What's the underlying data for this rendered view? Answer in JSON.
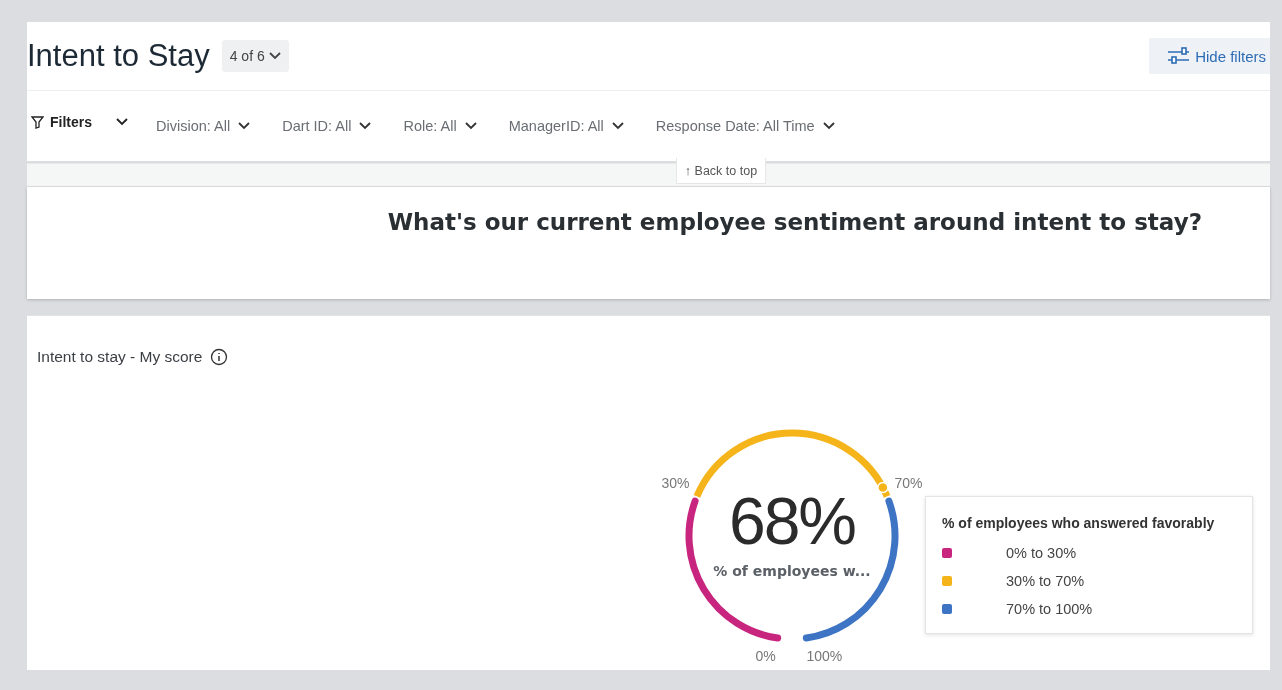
{
  "header": {
    "title": "Intent to Stay",
    "page_picker": "4 of 6",
    "hide_filters": "Hide filters"
  },
  "filters": {
    "label": "Filters",
    "items": [
      {
        "label": "Division:",
        "value": "All"
      },
      {
        "label": "Dart ID:",
        "value": "All"
      },
      {
        "label": "Role:",
        "value": "All"
      },
      {
        "label": "ManagerID:",
        "value": "All"
      },
      {
        "label": "Response Date:",
        "value": "All Time"
      }
    ]
  },
  "back_to_top": "↑ Back to top",
  "question": "What's our current employee sentiment around intent to stay?",
  "score_card": {
    "title": "Intent to stay - My score",
    "gauge": {
      "value": "68%",
      "caption": "% of employees w...",
      "ticks": [
        "0%",
        "30%",
        "70%",
        "100%"
      ]
    },
    "legend": {
      "title": "% of employees who answered favorably",
      "items": [
        {
          "label": "0% to 30%",
          "color": "#c8267e"
        },
        {
          "label": "30% to 70%",
          "color": "#f4b41a"
        },
        {
          "label": "70% to 100%",
          "color": "#3e74c4"
        }
      ]
    }
  }
}
